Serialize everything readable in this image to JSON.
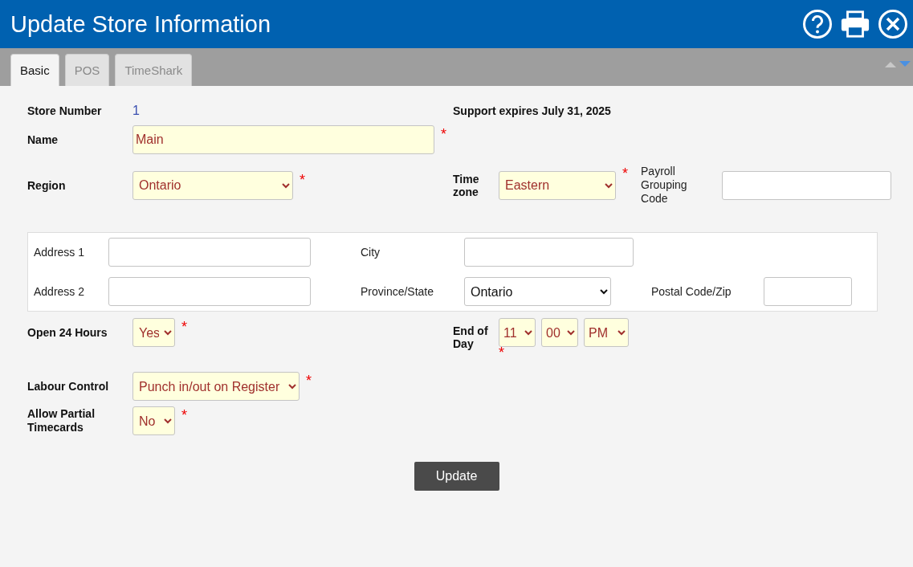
{
  "window": {
    "title": "Update Store Information"
  },
  "tabs": [
    {
      "label": "Basic",
      "selected": true
    },
    {
      "label": "POS",
      "selected": false
    },
    {
      "label": "TimeShark",
      "selected": false
    }
  ],
  "store_number": {
    "label": "Store Number",
    "value": "1"
  },
  "support": {
    "text": "Support expires July 31, 2025"
  },
  "required_mark": "*",
  "name": {
    "label": "Name",
    "value": "Main"
  },
  "region": {
    "label": "Region",
    "value": "Ontario"
  },
  "time_zone": {
    "label": "Time zone",
    "value": "Eastern"
  },
  "payroll_grouping_code": {
    "label": "Payroll Grouping Code"
  },
  "address": {
    "address1": {
      "label": "Address 1"
    },
    "address2": {
      "label": "Address 2"
    },
    "city": {
      "label": "City"
    },
    "province_state": {
      "label": "Province/State",
      "value": "Ontario"
    },
    "postal_code": {
      "label": "Postal Code/Zip"
    }
  },
  "open_24_hours": {
    "label": "Open 24 Hours",
    "value": "Yes"
  },
  "end_of_day": {
    "label": "End of Day",
    "hour": "11",
    "minute": "00",
    "meridiem": "PM"
  },
  "labour_control": {
    "label": "Labour Control",
    "value": "Punch in/out on Register"
  },
  "allow_partial_timecards": {
    "label": "Allow Partial Timecards",
    "value": "No"
  },
  "update_button": {
    "label": "Update"
  }
}
